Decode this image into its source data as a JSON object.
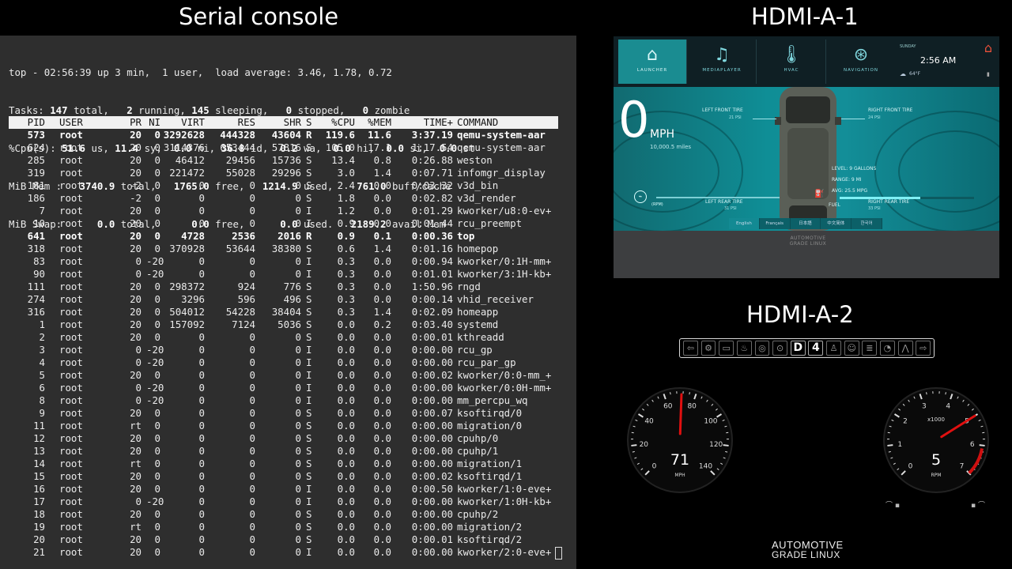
{
  "titles": {
    "console": "Serial console",
    "hdmi1": "HDMI-A-1",
    "hdmi2": "HDMI-A-2"
  },
  "top": {
    "line1": "top - 02:56:39 up 3 min,  1 user,  load average: 3.46, 1.78, 0.72",
    "tasks": {
      "total": "147",
      "running": "2",
      "sleeping": "145",
      "stopped": "0",
      "zombie": "0"
    },
    "cpu": {
      "us": "51.6",
      "sy": "11.4",
      "ni": "0.0",
      "id": "36.8",
      "wa": "0.2",
      "hi": "0.0",
      "si": "0.0",
      "st": "0.0"
    },
    "mem": {
      "total": "3740.9",
      "free": "1765.0",
      "used": "1214.9",
      "buff": "761.0"
    },
    "swap": {
      "total": "0.0",
      "free": "0.0",
      "used": "0.0",
      "avail": "2189.2"
    },
    "columns": [
      "PID",
      "USER",
      "PR",
      "NI",
      "VIRT",
      "RES",
      "SHR",
      "S",
      "%CPU",
      "%MEM",
      "TIME+",
      "COMMAND"
    ],
    "processes": [
      [
        "573",
        "root",
        "20",
        "0",
        "3292628",
        "444328",
        "43604",
        "R",
        "119.6",
        "11.6",
        "3:37.19",
        "qemu-system-aar",
        true
      ],
      [
        "624",
        "root",
        "20",
        "0",
        "3114376",
        "653444",
        "57816",
        "S",
        "105.0",
        "17.1",
        "1:17.54",
        "qemu-system-aar",
        false
      ],
      [
        "285",
        "root",
        "20",
        "0",
        "46412",
        "29456",
        "15736",
        "S",
        "13.4",
        "0.8",
        "0:26.88",
        "weston",
        false
      ],
      [
        "319",
        "root",
        "20",
        "0",
        "221472",
        "55028",
        "29296",
        "S",
        "3.0",
        "1.4",
        "0:07.71",
        "infomgr_display",
        false
      ],
      [
        "181",
        "root",
        "-2",
        "0",
        "0",
        "0",
        "0",
        "S",
        "2.4",
        "0.0",
        "0:03.32",
        "v3d_bin",
        false
      ],
      [
        "186",
        "root",
        "-2",
        "0",
        "0",
        "0",
        "0",
        "S",
        "1.8",
        "0.0",
        "0:02.82",
        "v3d_render",
        false
      ],
      [
        "7",
        "root",
        "20",
        "0",
        "0",
        "0",
        "0",
        "I",
        "1.2",
        "0.0",
        "0:01.29",
        "kworker/u8:0-ev+",
        false
      ],
      [
        "10",
        "root",
        "20",
        "0",
        "0",
        "0",
        "0",
        "I",
        "0.9",
        "0.0",
        "0:01.44",
        "rcu_preempt",
        false
      ],
      [
        "641",
        "root",
        "20",
        "0",
        "4728",
        "2536",
        "2016",
        "R",
        "0.9",
        "0.1",
        "0:00.36",
        "top",
        true
      ],
      [
        "318",
        "root",
        "20",
        "0",
        "370928",
        "53644",
        "38380",
        "S",
        "0.6",
        "1.4",
        "0:01.16",
        "homepop",
        false
      ],
      [
        "83",
        "root",
        "0",
        "-20",
        "0",
        "0",
        "0",
        "I",
        "0.3",
        "0.0",
        "0:00.94",
        "kworker/0:1H-mm+",
        false
      ],
      [
        "90",
        "root",
        "0",
        "-20",
        "0",
        "0",
        "0",
        "I",
        "0.3",
        "0.0",
        "0:01.01",
        "kworker/3:1H-kb+",
        false
      ],
      [
        "111",
        "root",
        "20",
        "0",
        "298372",
        "924",
        "776",
        "S",
        "0.3",
        "0.0",
        "1:50.96",
        "rngd",
        false
      ],
      [
        "274",
        "root",
        "20",
        "0",
        "3296",
        "596",
        "496",
        "S",
        "0.3",
        "0.0",
        "0:00.14",
        "vhid_receiver",
        false
      ],
      [
        "316",
        "root",
        "20",
        "0",
        "504012",
        "54228",
        "38404",
        "S",
        "0.3",
        "1.4",
        "0:02.09",
        "homeapp",
        false
      ],
      [
        "1",
        "root",
        "20",
        "0",
        "157092",
        "7124",
        "5036",
        "S",
        "0.0",
        "0.2",
        "0:03.40",
        "systemd",
        false
      ],
      [
        "2",
        "root",
        "20",
        "0",
        "0",
        "0",
        "0",
        "S",
        "0.0",
        "0.0",
        "0:00.01",
        "kthreadd",
        false
      ],
      [
        "3",
        "root",
        "0",
        "-20",
        "0",
        "0",
        "0",
        "I",
        "0.0",
        "0.0",
        "0:00.00",
        "rcu_gp",
        false
      ],
      [
        "4",
        "root",
        "0",
        "-20",
        "0",
        "0",
        "0",
        "I",
        "0.0",
        "0.0",
        "0:00.00",
        "rcu_par_gp",
        false
      ],
      [
        "5",
        "root",
        "20",
        "0",
        "0",
        "0",
        "0",
        "I",
        "0.0",
        "0.0",
        "0:00.02",
        "kworker/0:0-mm_+",
        false
      ],
      [
        "6",
        "root",
        "0",
        "-20",
        "0",
        "0",
        "0",
        "I",
        "0.0",
        "0.0",
        "0:00.00",
        "kworker/0:0H-mm+",
        false
      ],
      [
        "8",
        "root",
        "0",
        "-20",
        "0",
        "0",
        "0",
        "I",
        "0.0",
        "0.0",
        "0:00.00",
        "mm_percpu_wq",
        false
      ],
      [
        "9",
        "root",
        "20",
        "0",
        "0",
        "0",
        "0",
        "S",
        "0.0",
        "0.0",
        "0:00.07",
        "ksoftirqd/0",
        false
      ],
      [
        "11",
        "root",
        "rt",
        "0",
        "0",
        "0",
        "0",
        "S",
        "0.0",
        "0.0",
        "0:00.00",
        "migration/0",
        false
      ],
      [
        "12",
        "root",
        "20",
        "0",
        "0",
        "0",
        "0",
        "S",
        "0.0",
        "0.0",
        "0:00.00",
        "cpuhp/0",
        false
      ],
      [
        "13",
        "root",
        "20",
        "0",
        "0",
        "0",
        "0",
        "S",
        "0.0",
        "0.0",
        "0:00.00",
        "cpuhp/1",
        false
      ],
      [
        "14",
        "root",
        "rt",
        "0",
        "0",
        "0",
        "0",
        "S",
        "0.0",
        "0.0",
        "0:00.00",
        "migration/1",
        false
      ],
      [
        "15",
        "root",
        "20",
        "0",
        "0",
        "0",
        "0",
        "S",
        "0.0",
        "0.0",
        "0:00.02",
        "ksoftirqd/1",
        false
      ],
      [
        "16",
        "root",
        "20",
        "0",
        "0",
        "0",
        "0",
        "I",
        "0.0",
        "0.0",
        "0:00.50",
        "kworker/1:0-eve+",
        false
      ],
      [
        "17",
        "root",
        "0",
        "-20",
        "0",
        "0",
        "0",
        "I",
        "0.0",
        "0.0",
        "0:00.00",
        "kworker/1:0H-kb+",
        false
      ],
      [
        "18",
        "root",
        "20",
        "0",
        "0",
        "0",
        "0",
        "S",
        "0.0",
        "0.0",
        "0:00.00",
        "cpuhp/2",
        false
      ],
      [
        "19",
        "root",
        "rt",
        "0",
        "0",
        "0",
        "0",
        "S",
        "0.0",
        "0.0",
        "0:00.00",
        "migration/2",
        false
      ],
      [
        "20",
        "root",
        "20",
        "0",
        "0",
        "0",
        "0",
        "S",
        "0.0",
        "0.0",
        "0:00.01",
        "ksoftirqd/2",
        false
      ],
      [
        "21",
        "root",
        "20",
        "0",
        "0",
        "0",
        "0",
        "I",
        "0.0",
        "0.0",
        "0:00.00",
        "kworker/2:0-eve+",
        false
      ]
    ]
  },
  "ivi": {
    "nav": [
      {
        "label": "LAUNCHER",
        "icon": "home-icon",
        "active": true
      },
      {
        "label": "MEDIAPLAYER",
        "icon": "music-note-icon",
        "active": false
      },
      {
        "label": "HVAC",
        "icon": "thermometer-icon",
        "active": false
      },
      {
        "label": "NAVIGATION",
        "icon": "steering-wheel-icon",
        "active": false
      }
    ],
    "clock": {
      "day": "SUNDAY",
      "time": "2:56 AM",
      "temp": "64°F"
    },
    "speed": "0",
    "speed_unit": "MPH",
    "odometer": "10,000.5 miles",
    "rpm_label": "(RPM)",
    "tires": {
      "left_front": {
        "label": "LEFT FRONT TIRE",
        "value": "21 PSI"
      },
      "right_front": {
        "label": "RIGHT FRONT TIRE",
        "value": "24 PSI"
      },
      "left_rear": {
        "label": "LEFT REAR TIRE",
        "value": "31 PSI"
      },
      "right_rear": {
        "label": "RIGHT REAR TIRE",
        "value": "33 PSI"
      }
    },
    "fuel": {
      "level": "LEVEL: 9 GALLONS",
      "range": "RANGE: 9 MI",
      "avg": "AVG: 25.5 MPG",
      "label": "FUEL",
      "fill": 0.6
    },
    "languages": [
      {
        "label": "English",
        "active": true
      },
      {
        "label": "Français",
        "active": false
      },
      {
        "label": "日本語",
        "active": false
      },
      {
        "label": "中文简体",
        "active": false
      },
      {
        "label": "한국어",
        "active": false
      }
    ],
    "logo": {
      "line1": "AUTOMOTIVE",
      "line2": "GRADE LINUX"
    }
  },
  "cluster": {
    "telltales": [
      "left-arrow-icon",
      "engine-icon",
      "battery-icon",
      "oil-icon",
      "brake-icon",
      "abs-icon",
      "D",
      "4",
      "seatbelt-icon",
      "airbag-icon",
      "headlight-icon",
      "cruise-icon",
      "traction-icon",
      "right-arrow-icon"
    ],
    "speed": {
      "value": 71,
      "unit": "MPH",
      "max": 140,
      "ticks": [
        "0",
        "20",
        "40",
        "60",
        "80",
        "100",
        "120",
        "140"
      ]
    },
    "rpm": {
      "value": 5,
      "unit": "RPM",
      "scale": "x1000",
      "max": 7,
      "ticks": [
        "0",
        "1",
        "2",
        "3",
        "4",
        "5",
        "6",
        "7"
      ]
    },
    "logo": {
      "line1": "AUTOMOTIVE",
      "line2": "GRADE LINUX"
    }
  },
  "colors": {
    "ivi_accent": "#1a8c91",
    "needle": "#e01010",
    "terminal_bg": "#2e2e2e"
  }
}
